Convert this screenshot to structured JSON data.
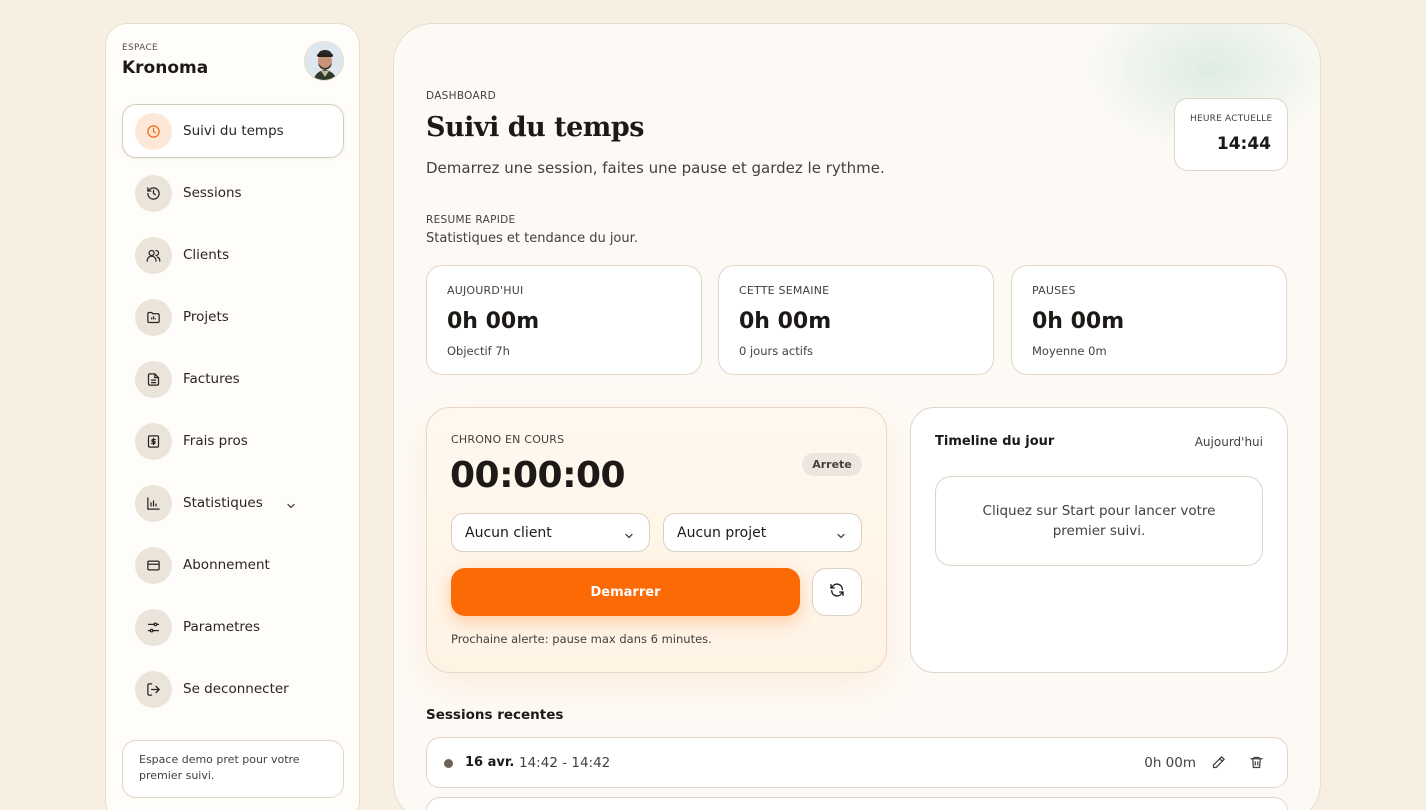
{
  "workspace": {
    "kicker": "ESPACE",
    "name": "Kronoma"
  },
  "sidebar": {
    "items": [
      {
        "label": "Suivi du temps",
        "icon": "clock-icon",
        "active": true
      },
      {
        "label": "Sessions",
        "icon": "history-icon"
      },
      {
        "label": "Clients",
        "icon": "users-icon"
      },
      {
        "label": "Projets",
        "icon": "folder-icon"
      },
      {
        "label": "Factures",
        "icon": "file-text-icon"
      },
      {
        "label": "Frais pros",
        "icon": "receipt-dollar-icon"
      },
      {
        "label": "Statistiques",
        "icon": "bar-chart-icon",
        "expandable": true
      },
      {
        "label": "Abonnement",
        "icon": "credit-card-icon"
      },
      {
        "label": "Parametres",
        "icon": "sliders-icon"
      },
      {
        "label": "Se deconnecter",
        "icon": "logout-icon"
      }
    ],
    "note": "Espace demo pret pour votre premier suivi."
  },
  "header": {
    "kicker": "DASHBOARD",
    "title": "Suivi du temps",
    "subtitle": "Demarrez une session, faites une pause et gardez le rythme.",
    "clock_label": "HEURE ACTUELLE",
    "clock_time": "14:44"
  },
  "summary": {
    "kicker": "RESUME RAPIDE",
    "subtitle": "Statistiques et tendance du jour.",
    "cards": [
      {
        "label": "AUJOURD'HUI",
        "value": "0h 00m",
        "note": "Objectif 7h"
      },
      {
        "label": "CETTE SEMAINE",
        "value": "0h 00m",
        "note": "0 jours actifs"
      },
      {
        "label": "PAUSES",
        "value": "0h 00m",
        "note": "Moyenne 0m"
      }
    ]
  },
  "chrono": {
    "kicker": "CHRONO EN COURS",
    "time": "00:00:00",
    "status": "Arrete",
    "client": "Aucun client",
    "project": "Aucun projet",
    "start_label": "Demarrer",
    "alert": "Prochaine alerte: pause max dans 6 minutes."
  },
  "timeline": {
    "title": "Timeline du jour",
    "day": "Aujourd'hui",
    "empty": "Cliquez sur Start pour lancer votre premier suivi."
  },
  "recent": {
    "title": "Sessions recentes",
    "rows": [
      {
        "date": "16 avr.",
        "range": "14:42 - 14:42",
        "duration": "0h 00m"
      }
    ]
  },
  "colors": {
    "accent": "#fb6a05",
    "background": "#f8efe3",
    "surface": "#ffffff"
  }
}
